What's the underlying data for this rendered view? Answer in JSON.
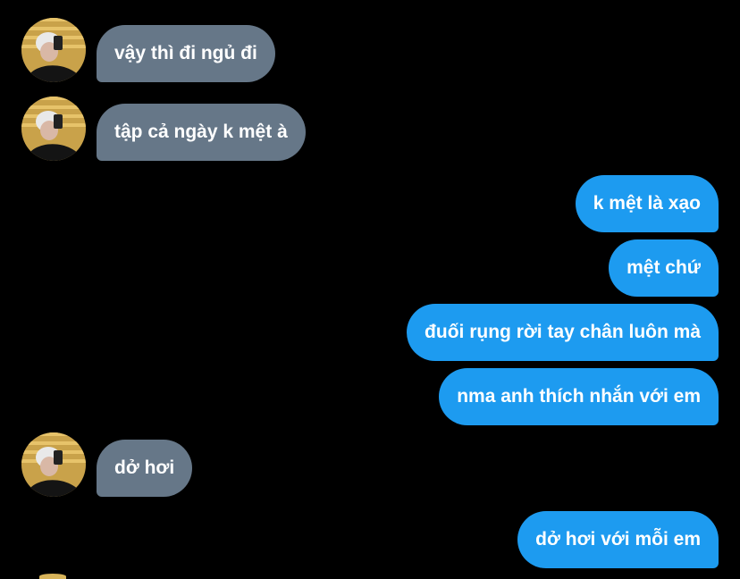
{
  "colors": {
    "background": "#000000",
    "incoming_bubble": "#667788",
    "outgoing_bubble": "#1d9bf0",
    "text": "#ffffff"
  },
  "conversation": {
    "messages": [
      {
        "direction": "incoming",
        "text": "vậy thì đi ngủ đi",
        "avatar": "user-avatar-photo"
      },
      {
        "direction": "incoming",
        "text": "tập cả ngày k mệt à",
        "avatar": "user-avatar-photo"
      },
      {
        "direction": "outgoing",
        "text": "k mệt là xạo"
      },
      {
        "direction": "outgoing",
        "text": "mệt chứ"
      },
      {
        "direction": "outgoing",
        "text": "đuối rụng rời tay chân luôn mà"
      },
      {
        "direction": "outgoing",
        "text": "nma anh thích nhắn với em"
      },
      {
        "direction": "incoming",
        "text": "dở hơi",
        "avatar": "user-avatar-photo"
      },
      {
        "direction": "outgoing",
        "text": "dở hơi với mỗi em"
      }
    ]
  }
}
